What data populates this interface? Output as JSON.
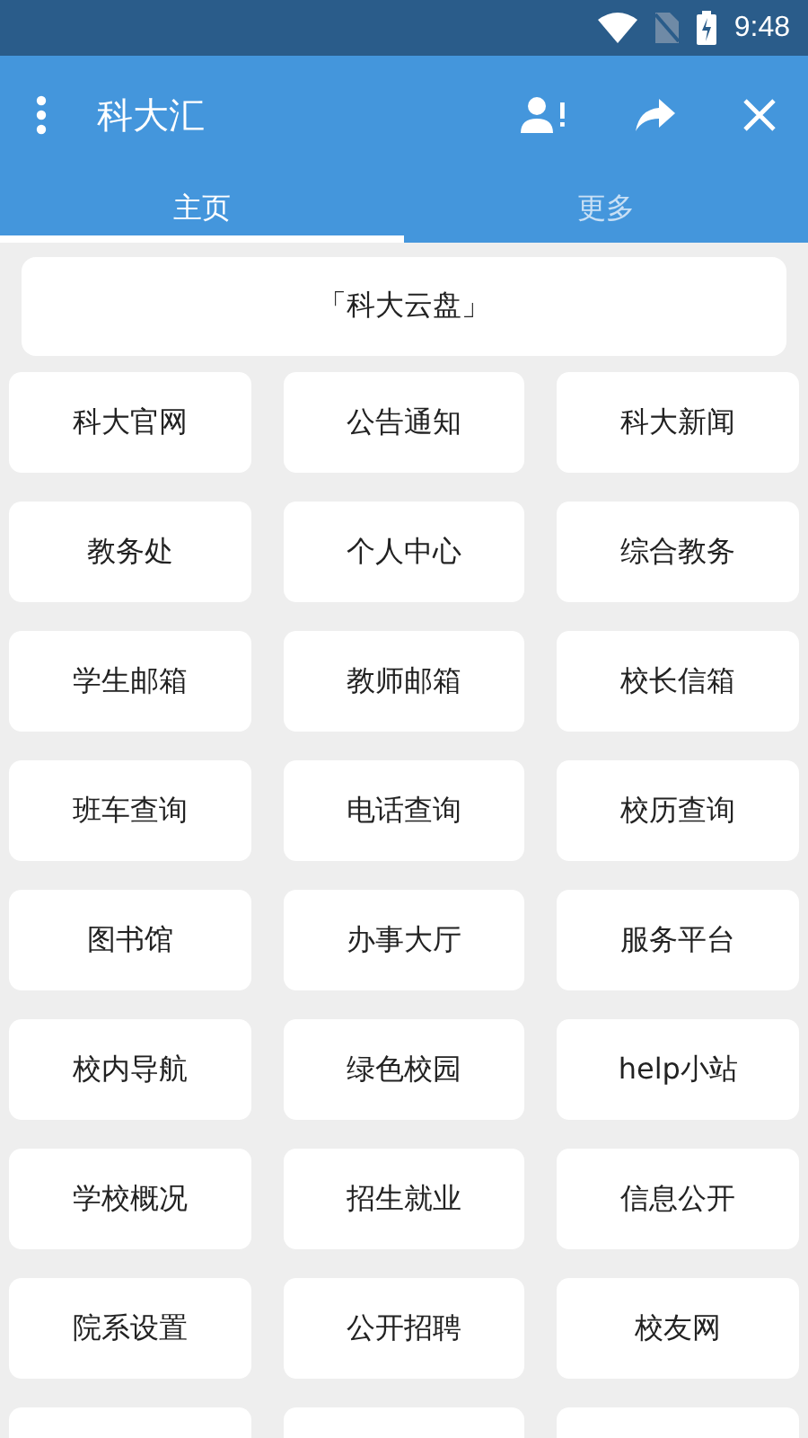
{
  "status_bar": {
    "time": "9:48"
  },
  "app_bar": {
    "title": "科大汇"
  },
  "tabs": [
    {
      "label": "主页",
      "selected": true
    },
    {
      "label": "更多",
      "selected": false
    }
  ],
  "banner": {
    "label": "「科大云盘」"
  },
  "tiles": [
    {
      "label": "科大官网"
    },
    {
      "label": "公告通知"
    },
    {
      "label": "科大新闻"
    },
    {
      "label": "教务处"
    },
    {
      "label": "个人中心"
    },
    {
      "label": "综合教务"
    },
    {
      "label": "学生邮箱"
    },
    {
      "label": "教师邮箱"
    },
    {
      "label": "校长信箱"
    },
    {
      "label": "班车查询"
    },
    {
      "label": "电话查询"
    },
    {
      "label": "校历查询"
    },
    {
      "label": "图书馆"
    },
    {
      "label": "办事大厅"
    },
    {
      "label": "服务平台"
    },
    {
      "label": "校内导航"
    },
    {
      "label": "绿色校园"
    },
    {
      "label": "help小站"
    },
    {
      "label": "学校概况"
    },
    {
      "label": "招生就业"
    },
    {
      "label": "信息公开"
    },
    {
      "label": "院系设置"
    },
    {
      "label": "公开招聘"
    },
    {
      "label": "校友网"
    }
  ]
}
